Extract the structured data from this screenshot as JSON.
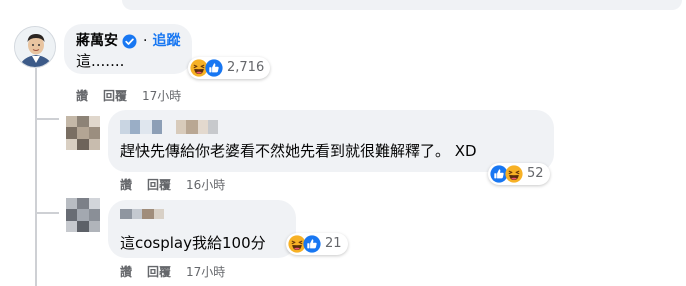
{
  "comments": [
    {
      "author": "蔣萬安",
      "verified": true,
      "separator": "·",
      "follow_label": "追蹤",
      "text": "這.......",
      "reaction_count": "2,716",
      "reactions": [
        "haha-icon",
        "like-icon"
      ],
      "actions": {
        "like": "讚",
        "reply": "回覆",
        "time": "17小時"
      }
    },
    {
      "text": "趕快先傳給你老婆看不然她先看到就很難解釋了。 XD",
      "reaction_count": "52",
      "reactions": [
        "like-icon",
        "haha-icon"
      ],
      "actions": {
        "like": "讚",
        "reply": "回覆",
        "time": "16小時"
      }
    },
    {
      "text": "這cosplay我給100分",
      "reaction_count": "21",
      "reactions": [
        "haha-icon",
        "like-icon"
      ],
      "actions": {
        "like": "讚",
        "reply": "回覆",
        "time": "17小時"
      }
    }
  ],
  "colors": {
    "bubble": "#f0f2f5",
    "accent": "#1877f2",
    "secondary_text": "#65676b",
    "haha": "#f7b125"
  }
}
